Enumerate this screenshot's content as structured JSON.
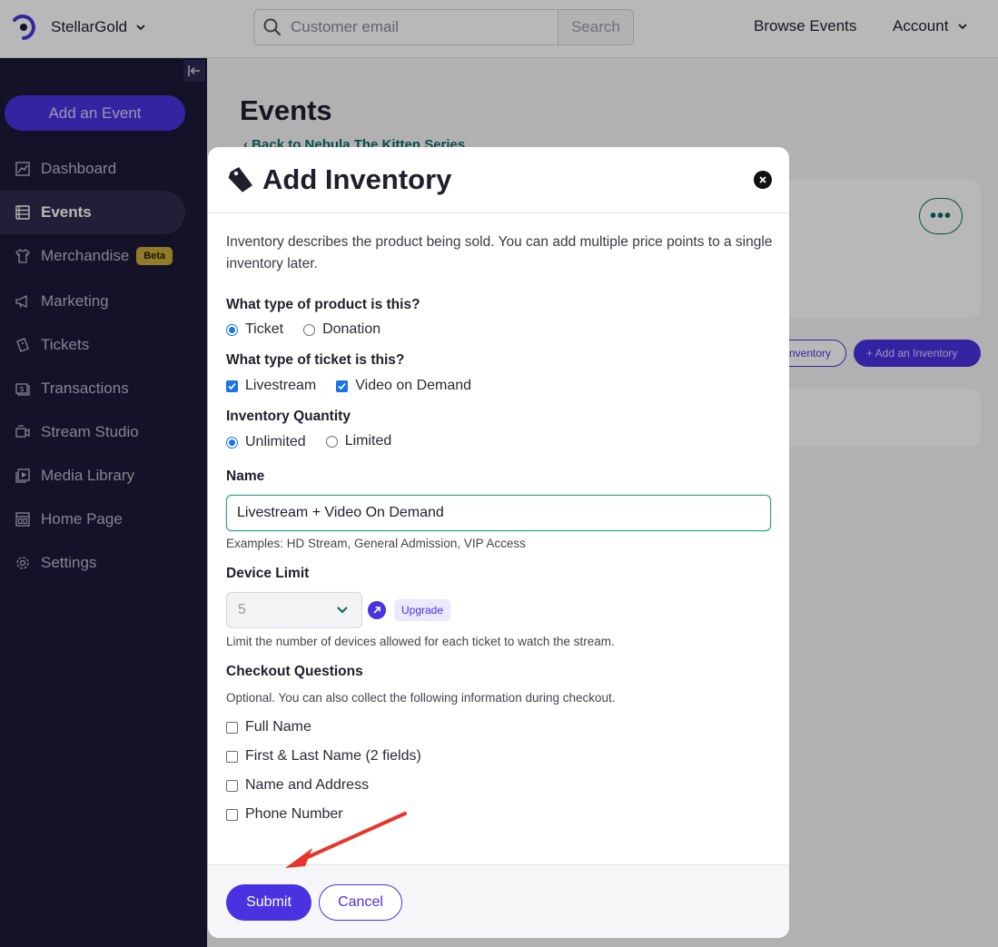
{
  "topbar": {
    "org_name": "StellarGold",
    "search_placeholder": "Customer email",
    "search_button": "Search",
    "browse_events": "Browse Events",
    "account": "Account"
  },
  "sidebar": {
    "add_event": "Add an Event",
    "items": [
      {
        "label": "Dashboard",
        "icon": "chart-icon"
      },
      {
        "label": "Events",
        "icon": "events-icon",
        "active": true
      },
      {
        "label": "Merchandise",
        "icon": "shirt-icon",
        "badge": "Beta"
      },
      {
        "label": "Marketing",
        "icon": "megaphone-icon"
      },
      {
        "label": "Tickets",
        "icon": "ticket-icon"
      },
      {
        "label": "Transactions",
        "icon": "money-icon"
      },
      {
        "label": "Stream Studio",
        "icon": "studio-icon"
      },
      {
        "label": "Media Library",
        "icon": "media-icon"
      },
      {
        "label": "Home Page",
        "icon": "home-page-icon"
      },
      {
        "label": "Settings",
        "icon": "gear-icon"
      }
    ]
  },
  "main": {
    "title": "Events",
    "back_link": "Back to Nebula The Kitten Series",
    "inventory_outline_btn": "nventory",
    "add_inventory_btn": "+ Add an Inventory"
  },
  "modal": {
    "title": "Add Inventory",
    "intro": "Inventory describes the product being sold. You can add multiple price points to a single inventory later.",
    "product_type": {
      "label": "What type of product is this?",
      "options": [
        "Ticket",
        "Donation"
      ],
      "selected": "Ticket"
    },
    "ticket_type": {
      "label": "What type of ticket is this?",
      "options": [
        "Livestream",
        "Video on Demand"
      ],
      "checked": [
        "Livestream",
        "Video on Demand"
      ]
    },
    "quantity": {
      "label": "Inventory Quantity",
      "options": [
        "Unlimited",
        "Limited"
      ],
      "selected": "Unlimited"
    },
    "name": {
      "label": "Name",
      "value": "Livestream + Video On Demand",
      "hint": "Examples: HD Stream, General Admission, VIP Access"
    },
    "device_limit": {
      "label": "Device Limit",
      "value": "5",
      "upgrade": "Upgrade",
      "hint": "Limit the number of devices allowed for each ticket to watch the stream."
    },
    "checkout": {
      "label": "Checkout Questions",
      "hint": "Optional. You can also collect the following information during checkout.",
      "options": [
        "Full Name",
        "First & Last Name (2 fields)",
        "Name and Address",
        "Phone Number"
      ]
    },
    "submit": "Submit",
    "cancel": "Cancel"
  },
  "colors": {
    "accent": "#4a32e0",
    "sidebar_bg": "#1c1a3a",
    "teal": "#0e6e5a",
    "annotation_arrow": "#e8352a"
  }
}
